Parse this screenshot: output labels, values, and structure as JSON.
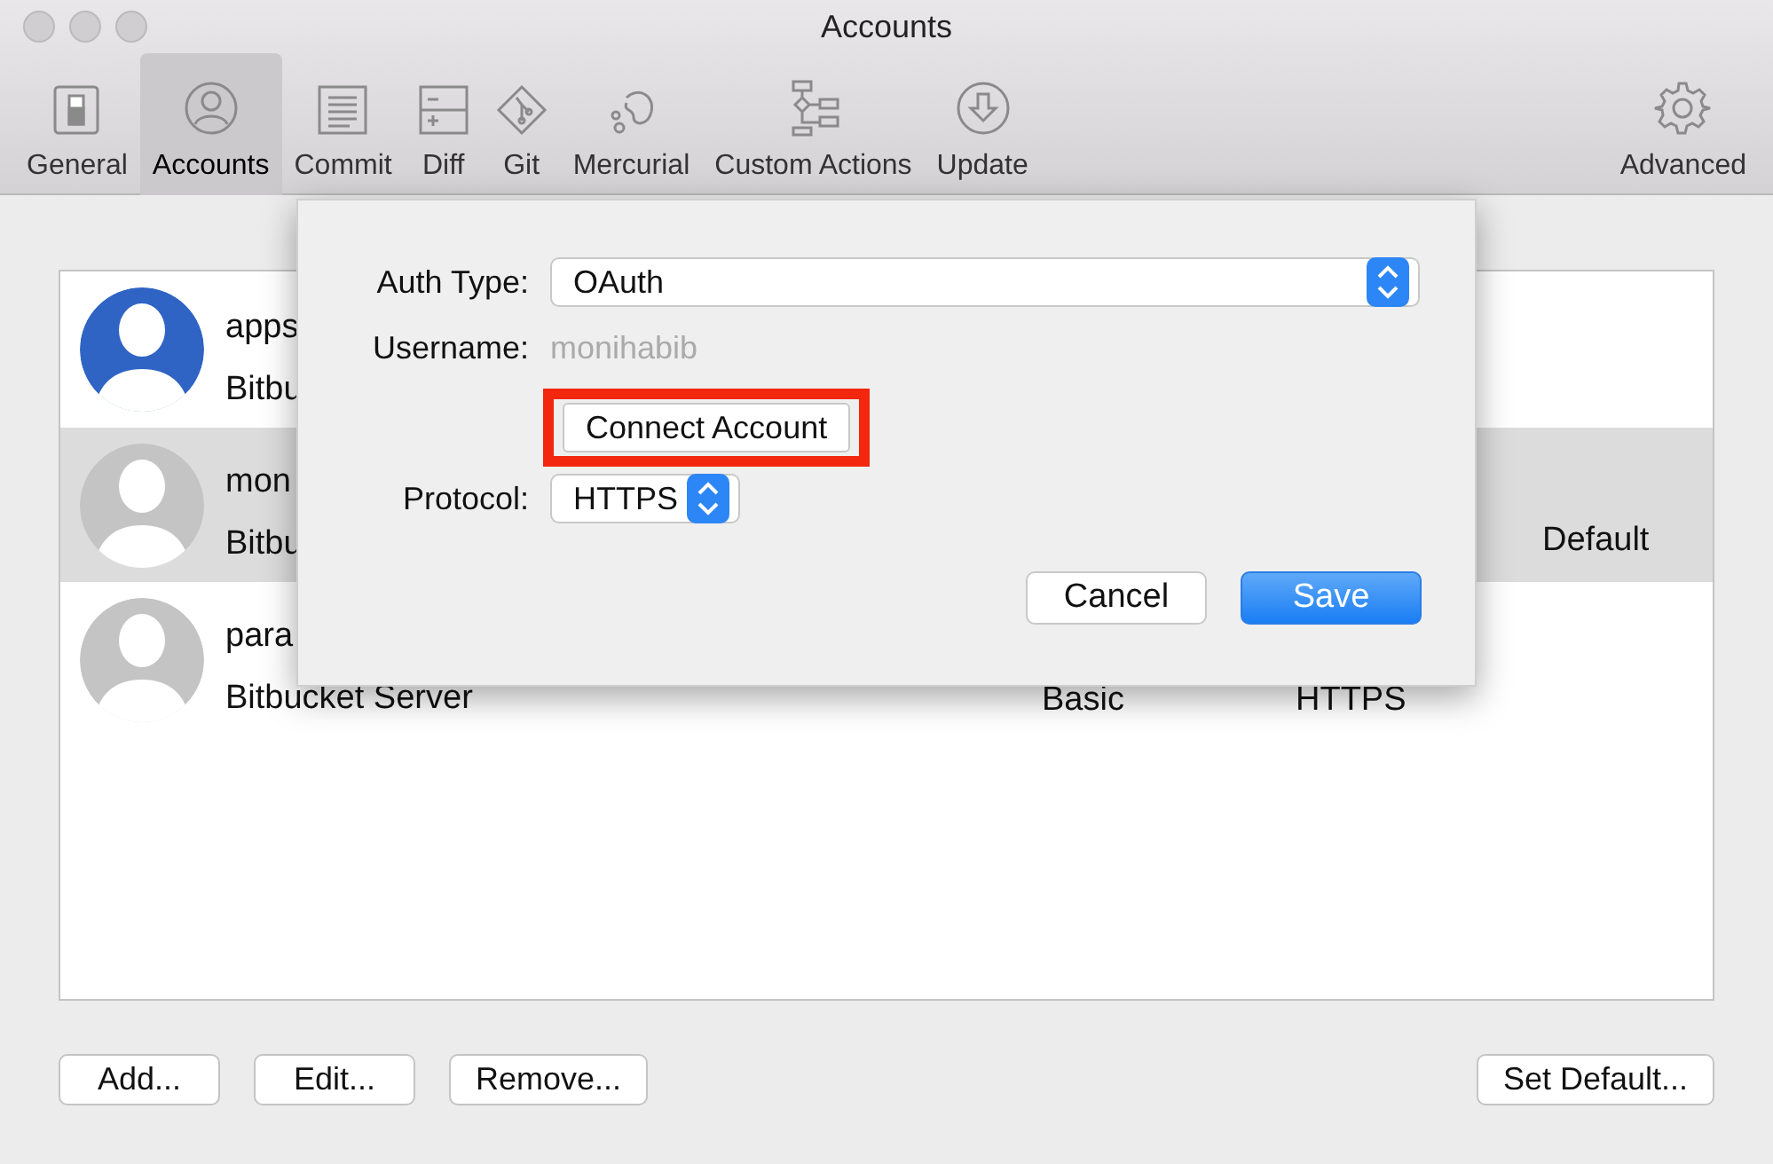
{
  "window": {
    "title": "Accounts"
  },
  "toolbar": [
    {
      "label": "General",
      "selected": false
    },
    {
      "label": "Accounts",
      "selected": true
    },
    {
      "label": "Commit",
      "selected": false
    },
    {
      "label": "Diff",
      "selected": false
    },
    {
      "label": "Git",
      "selected": false
    },
    {
      "label": "Mercurial",
      "selected": false
    },
    {
      "label": "Custom Actions",
      "selected": false
    },
    {
      "label": "Update",
      "selected": false
    },
    {
      "label": "Advanced",
      "selected": false
    }
  ],
  "accounts": [
    {
      "name": "apps",
      "host": "Bitbu",
      "kind": "highlighted",
      "selected": false
    },
    {
      "name": "mon",
      "host": "Bitbu",
      "status": "Default",
      "kind": "plain",
      "selected": true
    },
    {
      "name": "para",
      "host": "Bitbucket Server",
      "auth": "Basic",
      "protocol": "HTTPS",
      "kind": "plain",
      "selected": false
    }
  ],
  "dialog": {
    "auth_type": {
      "label": "Auth Type:",
      "value": "OAuth"
    },
    "username": {
      "label": "Username:",
      "value": "monihabib",
      "disabled": true
    },
    "connect_button": {
      "label": "Connect Account",
      "highlighted": true
    },
    "protocol": {
      "label": "Protocol:",
      "value": "HTTPS"
    },
    "buttons": [
      {
        "label": "Cancel",
        "default": false
      },
      {
        "label": "Save",
        "default": true
      }
    ]
  },
  "bottom_buttons": [
    {
      "label": "Add..."
    },
    {
      "label": "Edit..."
    },
    {
      "label": "Remove..."
    },
    {
      "label": "Set Default..."
    }
  ]
}
